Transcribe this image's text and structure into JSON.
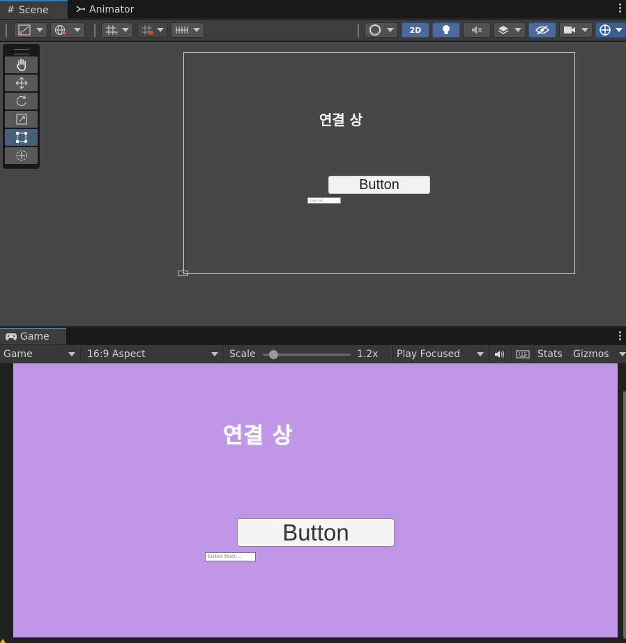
{
  "scene_tabs": {
    "scene_label": "Scene",
    "animator_label": "Animator"
  },
  "scene_toolbar": {
    "toggle_2d_label": "2D"
  },
  "scene_view": {
    "title_text": "연결 상",
    "button_label": "Button",
    "input_placeholder": "Enter text..."
  },
  "game_tabs": {
    "game_label": "Game"
  },
  "game_toolbar": {
    "display_select": "Game",
    "aspect_select": "16:9 Aspect",
    "scale_label": "Scale",
    "scale_value": "1.2x",
    "scale_fraction": 0.12,
    "play_mode_select": "Play Focused",
    "stats_label": "Stats",
    "gizmos_label": "Gizmos"
  },
  "game_view": {
    "title_text": "연결 상",
    "button_label": "Button",
    "input_placeholder": "Enter text...",
    "background_color": "#bf96e4"
  },
  "colors": {
    "accent": "#3a79bb",
    "toggle_blue": "#4a6b99"
  }
}
